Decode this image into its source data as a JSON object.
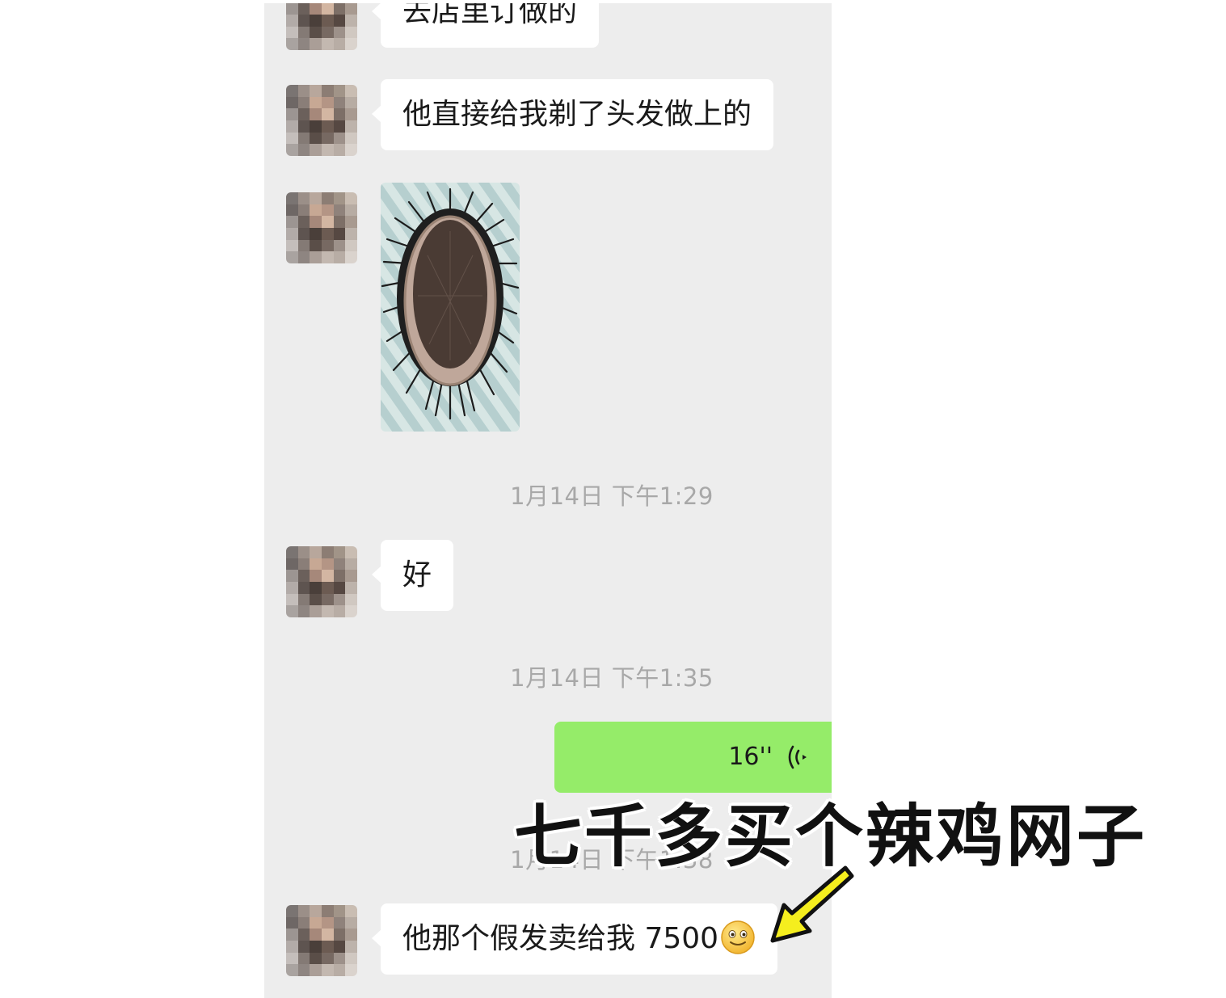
{
  "messages": {
    "m1_text": "去店里订做的",
    "m2_text": "他直接给我剃了头发做上的",
    "m3_text": "好",
    "m5_text": "他那个假发卖给我 7500"
  },
  "timestamps": {
    "t1": "1月14日 下午1:29",
    "t2": "1月14日 下午1:35",
    "t3": "1月14日 下午1:38"
  },
  "voice": {
    "duration": "16''"
  },
  "caption": {
    "text": "七千多买个辣鸡网子"
  },
  "colors": {
    "chat_background": "#ededed",
    "incoming_bubble": "#ffffff",
    "outgoing_bubble": "#95ec69",
    "timestamp_text": "#a8a8a8",
    "arrow_fill": "#f5ee1e"
  },
  "icons": [
    "voice-wave-icon",
    "smile-emoji-icon",
    "arrow-icon"
  ]
}
